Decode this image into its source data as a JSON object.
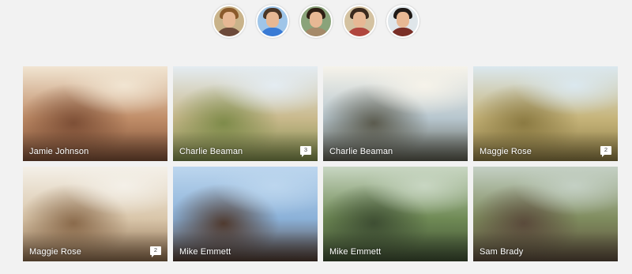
{
  "avatars": [
    {
      "name": "avatar-1",
      "hair": "#8a5a2b",
      "shirt": "#6d4a3a",
      "bg": "#c9b38a"
    },
    {
      "name": "avatar-2",
      "hair": "#4a3626",
      "shirt": "#3a7bd5",
      "bg": "#9fc5e8"
    },
    {
      "name": "avatar-3",
      "hair": "#2e1f14",
      "shirt": "#a58a6a",
      "bg": "#8aa37a"
    },
    {
      "name": "avatar-4",
      "hair": "#3b2a1d",
      "shirt": "#b0463e",
      "bg": "#d4c2a1"
    },
    {
      "name": "avatar-5",
      "hair": "#1f1a17",
      "shirt": "#7a2f27",
      "bg": "#dfe6ea"
    }
  ],
  "tiles": [
    {
      "name": "Jamie Johnson",
      "comments": null,
      "palette": [
        "#f1e5d2",
        "#c08d68",
        "#7d4f36"
      ]
    },
    {
      "name": "Charlie Beaman",
      "comments": "3",
      "palette": [
        "#e4ecf2",
        "#c9b98c",
        "#7e8b4a"
      ]
    },
    {
      "name": "Charlie Beaman",
      "comments": null,
      "palette": [
        "#f6f3ea",
        "#b7c6ce",
        "#5b5b4e"
      ]
    },
    {
      "name": "Maggie Rose",
      "comments": "2",
      "palette": [
        "#dbe8ef",
        "#c6b47a",
        "#8b7a42"
      ]
    },
    {
      "name": "Maggie Rose",
      "comments": "2",
      "palette": [
        "#f4f0e8",
        "#d9c6aa",
        "#8a6a4b"
      ]
    },
    {
      "name": "Mike Emmett",
      "comments": null,
      "palette": [
        "#bcd6ee",
        "#8bb1d8",
        "#4f3a2f"
      ]
    },
    {
      "name": "Mike Emmett",
      "comments": null,
      "palette": [
        "#c8d6c2",
        "#6f8a55",
        "#3e4e33"
      ]
    },
    {
      "name": "Sam Brady",
      "comments": null,
      "palette": [
        "#c4d0c4",
        "#7f8c5e",
        "#5a4a3b"
      ]
    }
  ]
}
